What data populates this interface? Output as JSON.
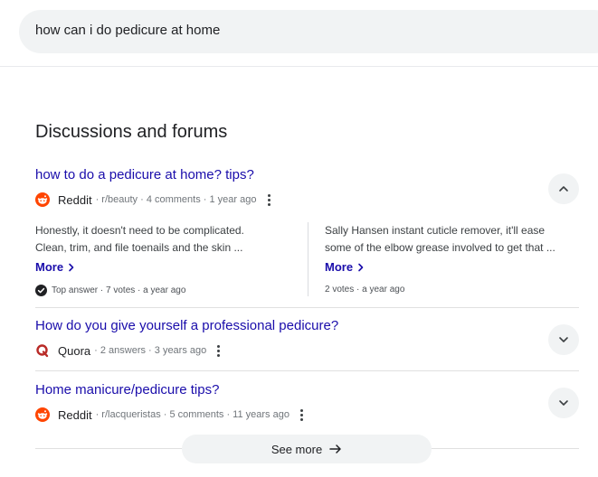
{
  "search": {
    "query": "how can i do pedicure at home"
  },
  "section": {
    "title": "Discussions and forums"
  },
  "threads": [
    {
      "title": "how to do a pedicure at home? tips?",
      "source": "Reddit",
      "meta": "· r/beauty · 4 comments · 1 year ago",
      "expanded": true,
      "answers": [
        {
          "line1": "Honestly, it doesn't need to be complicated.",
          "line2": "Clean, trim, and file toenails and the skin ...",
          "more": "More",
          "foot": "Top answer · 7 votes · a year ago"
        },
        {
          "line1": "Sally Hansen instant cuticle remover, it'll ease",
          "line2": "some of the elbow grease involved to get that ...",
          "more": "More",
          "foot": "2 votes · a year ago"
        }
      ]
    },
    {
      "title": "How do you give yourself a professional pedicure?",
      "source": "Quora",
      "meta": "· 2 answers · 3 years ago",
      "expanded": false
    },
    {
      "title": "Home manicure/pedicure tips?",
      "source": "Reddit",
      "meta": "· r/lacqueristas · 5 comments · 11 years ago",
      "expanded": false
    }
  ],
  "footer": {
    "see_more": "See more"
  },
  "colors": {
    "link": "#1a0dab",
    "reddit": "#ff4500",
    "quora": "#b92b27",
    "chip_bg": "#f1f3f4"
  },
  "icons": {
    "reddit": "reddit-logo-icon",
    "quora": "quora-logo-icon",
    "expand": "chevron-down-icon",
    "collapse": "chevron-up-icon",
    "more": "chevron-right-icon",
    "kebab": "more-vert-icon",
    "verified": "check-circle-icon",
    "arrow": "arrow-right-icon"
  }
}
